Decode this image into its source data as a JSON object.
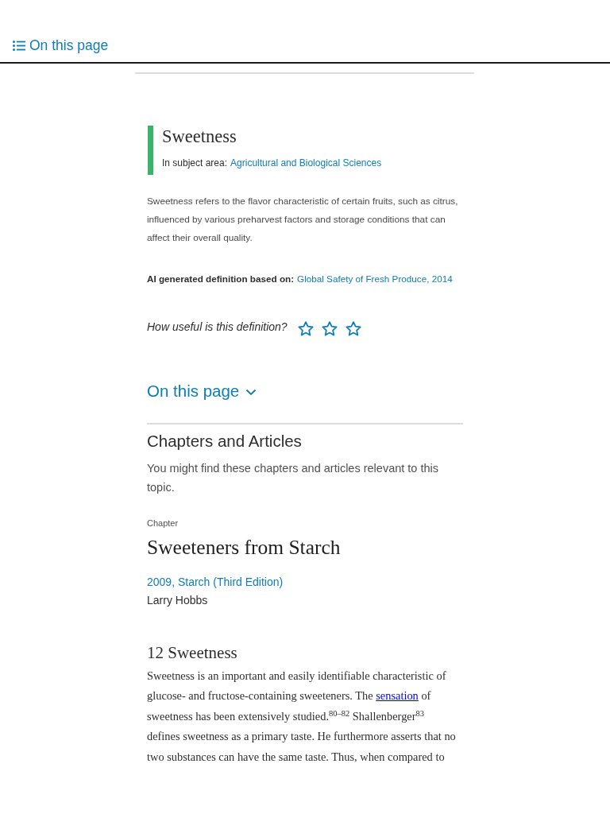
{
  "top_bar": {
    "toc_button": "On this page"
  },
  "term": {
    "title": "Sweetness",
    "subject_label": "In subject area:",
    "subject_link": "Agricultural and Biological Sciences"
  },
  "definition": {
    "text": "Sweetness refers to the flavor characteristic of certain fruits, such as citrus, influenced by various preharvest factors and storage conditions that can affect their overall quality.",
    "source_label": "AI generated definition based on:",
    "source_link": "Global Safety of Fresh Produce, 2014"
  },
  "rating": {
    "question": "How useful is this definition?",
    "stars": 0
  },
  "toc_toggle": {
    "label": "On this page",
    "expanded": false
  },
  "chapters_section": {
    "heading": "Chapters and Articles",
    "intro": "You might find these chapters and articles relevant to this topic.",
    "items": [
      {
        "type_label": "Chapter",
        "title": "Sweeteners from Starch",
        "source": "2009, Starch (Third Edition)",
        "author": "Larry Hobbs",
        "section_title": "12 Sweetness",
        "excerpt": [
          {
            "kind": "text",
            "text": "Sweetness is an important and easily identifiable characteristic of glucose- and fructose-containing sweeteners. The "
          },
          {
            "kind": "link",
            "text": "sensation"
          },
          {
            "kind": "text",
            "text": " of sweetness has been extensively studied.$^{80–82}$ Shallenberger$^{83}$ defines sweetness as a primary taste. He furthermore asserts that no two substances can have the same taste. Thus, when compared to"
          }
        ]
      }
    ]
  }
}
